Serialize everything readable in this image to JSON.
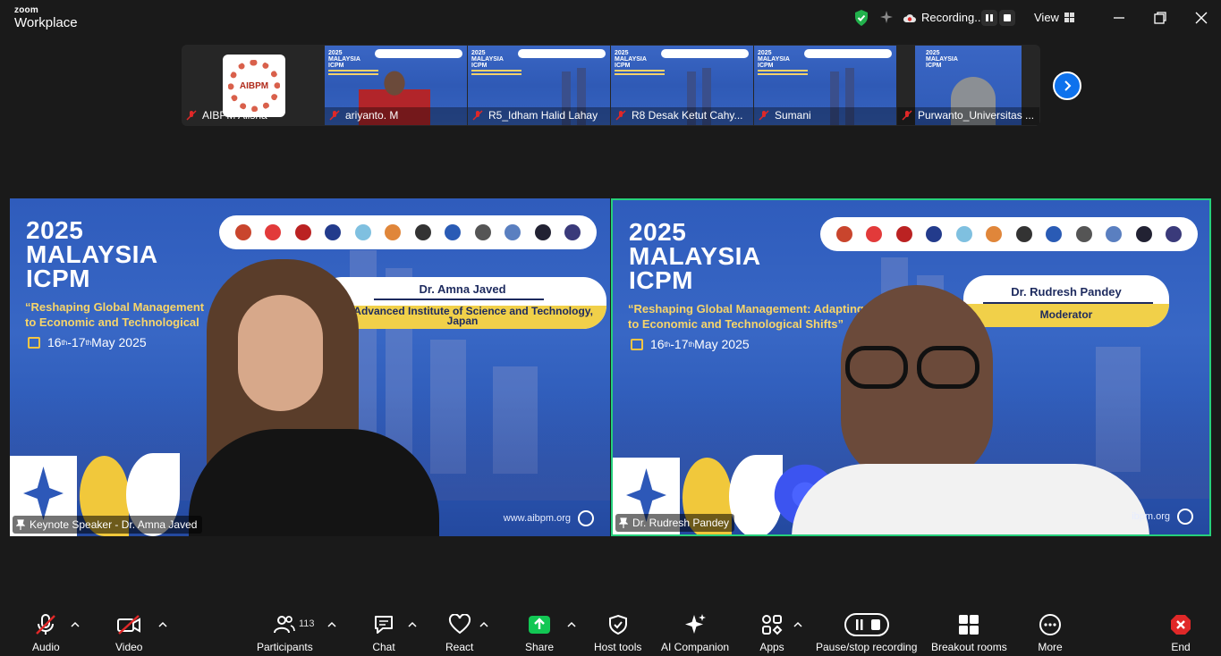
{
  "app": {
    "brand_small": "zoom",
    "brand_name": "Workplace"
  },
  "titlebar": {
    "recording_label": "Recording...",
    "view_label": "View",
    "icons": [
      "shield-check-icon",
      "sparkle-icon",
      "cloud-record-icon",
      "pause-icon",
      "stop-icon",
      "grid-icon",
      "minimize-icon",
      "restore-icon",
      "close-icon"
    ]
  },
  "thumbnails": [
    {
      "name": "AIBPM Alisha",
      "logo_text": "AIBPM",
      "muted": true
    },
    {
      "name": "ariyanto. M",
      "muted": true,
      "slide_year": "2025",
      "slide_country": "MALAYSIA",
      "slide_event": "ICPM"
    },
    {
      "name": "R5_Idham Halid Lahay",
      "muted": true,
      "slide_year": "2025",
      "slide_country": "MALAYSIA",
      "slide_event": "ICPM"
    },
    {
      "name": "R8 Desak Ketut Cahy...",
      "muted": true,
      "slide_year": "2025",
      "slide_country": "MALAYSIA",
      "slide_event": "ICPM"
    },
    {
      "name": "Sumani",
      "muted": true,
      "slide_year": "2025",
      "slide_country": "MALAYSIA",
      "slide_event": "ICPM"
    },
    {
      "name": "Purwanto_Universitas ...",
      "muted": true,
      "slide_year": "2025",
      "slide_country": "MALAYSIA",
      "slide_event": "ICPM"
    }
  ],
  "speakers": [
    {
      "label": "Keynote Speaker - Dr. Amna Javed",
      "year": "2025",
      "country": "MALAYSIA",
      "event": "ICPM",
      "theme_line1": "“Reshaping Global Management",
      "theme_line2": "to Economic and Technological",
      "date_start": "16",
      "date_start_sup": "th",
      "date_sep": " - ",
      "date_end": "17",
      "date_end_sup": "th",
      "date_rest": " May 2025",
      "pill_name": "Dr. Amna Javed",
      "pill_role_line1": "pan Advanced Institute of Science and Technology,",
      "pill_role_line2": "Japan",
      "url": "www.aibpm.org",
      "active": false
    },
    {
      "label": "Dr. Rudresh Pandey",
      "year": "2025",
      "country": "MALAYSIA",
      "event": "ICPM",
      "theme_line1": "“Reshaping Global Management: Adapting",
      "theme_line2": "to Economic and Technological Shifts”",
      "date_start": "16",
      "date_start_sup": "th",
      "date_sep": " - ",
      "date_end": "17",
      "date_end_sup": "th",
      "date_rest": " May 2025",
      "pill_name": "Dr. Rudresh Pandey",
      "pill_role_line1": "Moderator",
      "pill_role_line2": "",
      "url": "ibpm.org",
      "active": true,
      "active_border_color": "#26d07c"
    }
  ],
  "toolbar": {
    "audio": "Audio",
    "video": "Video",
    "participants": "Participants",
    "participants_count": "113",
    "chat": "Chat",
    "react": "React",
    "share": "Share",
    "host_tools": "Host tools",
    "ai_companion": "AI Companion",
    "apps": "Apps",
    "pause_stop_recording": "Pause/stop recording",
    "breakout_rooms": "Breakout rooms",
    "more": "More",
    "end": "End"
  },
  "colors": {
    "share_green": "#12c754",
    "end_red": "#e02828",
    "mute_red": "#e02828",
    "accent_blue": "#0e72ed",
    "active_speaker": "#26d07c"
  }
}
